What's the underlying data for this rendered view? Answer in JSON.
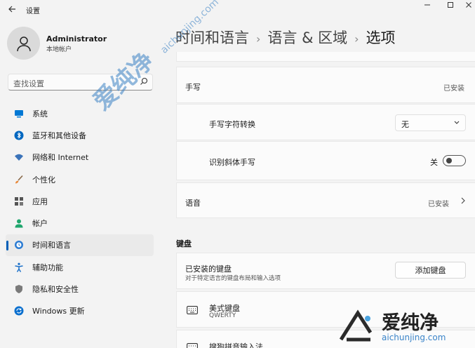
{
  "window": {
    "title": "设置",
    "back_icon": "arrow-left-icon",
    "controls": [
      "minimize-icon",
      "maximize-icon",
      "close-icon"
    ]
  },
  "profile": {
    "name": "Administrator",
    "account_type": "本地帐户"
  },
  "search": {
    "placeholder": "查找设置"
  },
  "sidebar": {
    "items": [
      {
        "label": "系统",
        "icon": "monitor-icon",
        "color": "#0078d4"
      },
      {
        "label": "蓝牙和其他设备",
        "icon": "bluetooth-icon",
        "color": "#0067c0"
      },
      {
        "label": "网络和 Internet",
        "icon": "wifi-icon",
        "color": "#3b73b9"
      },
      {
        "label": "个性化",
        "icon": "brush-icon",
        "color": "#e8893a"
      },
      {
        "label": "应用",
        "icon": "apps-icon",
        "color": "#555555"
      },
      {
        "label": "帐户",
        "icon": "person-icon",
        "color": "#1fa66d"
      },
      {
        "label": "时间和语言",
        "icon": "globe-clock-icon",
        "color": "#2b7cd3",
        "active": true
      },
      {
        "label": "辅助功能",
        "icon": "accessibility-icon",
        "color": "#1a6fc9"
      },
      {
        "label": "隐私和安全性",
        "icon": "shield-icon",
        "color": "#7a7a7a"
      },
      {
        "label": "Windows 更新",
        "icon": "update-icon",
        "color": "#0a6fce"
      }
    ]
  },
  "breadcrumb": {
    "part1": "时间和语言",
    "sep": "›",
    "part2": "语言 & 区域",
    "part3": "选项"
  },
  "handwriting": {
    "label": "手写",
    "status": "已安装",
    "conversion_label": "手写字符转换",
    "conversion_value": "无",
    "italic_label": "识别斜体手写",
    "italic_state": "关",
    "italic_on": false
  },
  "speech": {
    "label": "语音",
    "status": "已安装"
  },
  "keyboards": {
    "section_title": "键盘",
    "installed_label": "已安装的键盘",
    "installed_desc": "对于特定语言的键盘布局和输入选项",
    "add_button": "添加键盘",
    "items": [
      {
        "name": "美式键盘",
        "sub": "QWERTY",
        "icon": "keyboard-icon"
      },
      {
        "name": "搜狗拼音输入法",
        "sub": "",
        "icon": "keyboard-icon"
      }
    ]
  },
  "watermark": {
    "text": "爱纯净",
    "url": "aichunjing.com",
    "corner_text": "爱纯净",
    "corner_url": "aichunjing.com"
  }
}
